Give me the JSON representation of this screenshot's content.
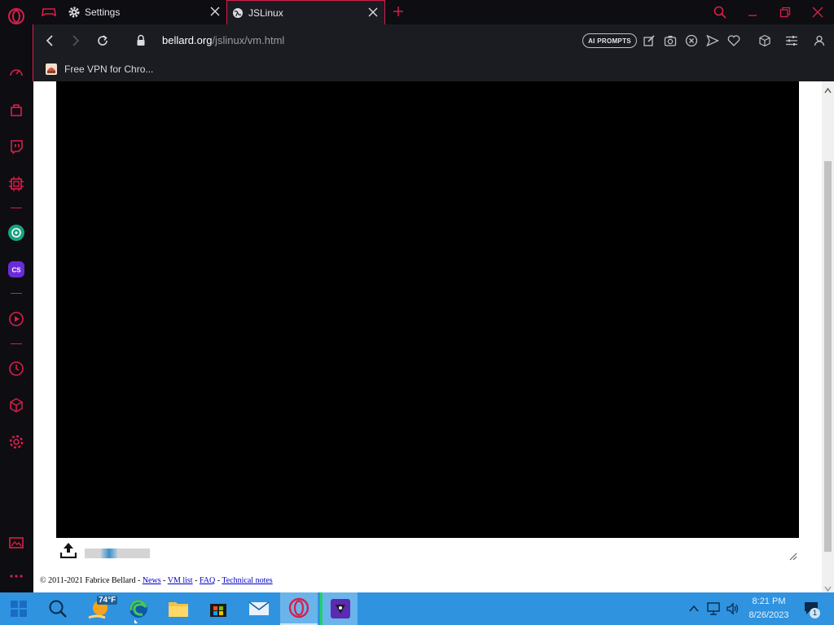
{
  "tabs": [
    {
      "label": "Settings"
    },
    {
      "label": "JSLinux"
    }
  ],
  "address": {
    "host": "bellard.org",
    "path": "/jslinux/vm.html",
    "ai_prompts_label": "AI PROMPTS"
  },
  "bookmarks": [
    {
      "label": "Free VPN for Chro..."
    }
  ],
  "footer": {
    "copyright": "© 2011-2021 Fabrice Bellard - ",
    "links": [
      "News",
      "VM list",
      "FAQ",
      "Technical notes"
    ],
    "sep": " - "
  },
  "upload_progress": 0.25,
  "taskbar": {
    "weather_temp": "74°F",
    "time": "8:21 PM",
    "date": "8/26/2023",
    "notification_count": "1"
  },
  "colors": {
    "accent": "#d81f4a",
    "chrome_bg": "#1b1b22",
    "sidebar_bg": "#0d0d12",
    "taskbar_bg": "#2f93e0"
  }
}
